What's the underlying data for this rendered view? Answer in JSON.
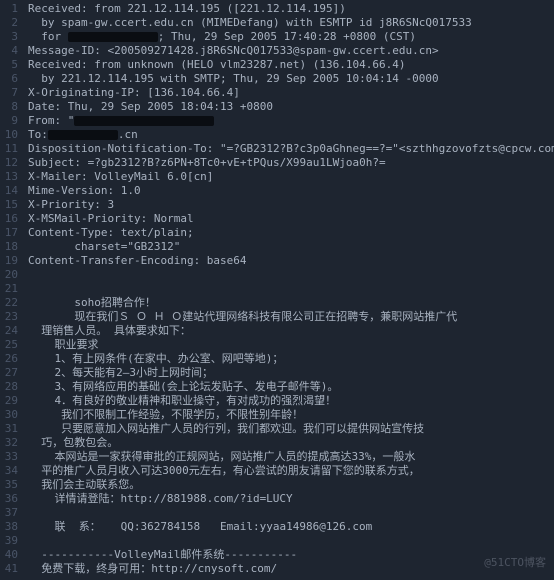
{
  "watermark": "@51CTO博客",
  "lines": [
    {
      "n": 1,
      "t": "Received: from 221.12.114.195 ([221.12.114.195])"
    },
    {
      "n": 2,
      "t": "  by spam-gw.ccert.edu.cn (MIMEDefang) with ESMTP id j8R6SNcQ017533"
    },
    {
      "n": 3,
      "t": "  for [REDACT:w1]; Thu, 29 Sep 2005 17:40:28 +0800 (CST)"
    },
    {
      "n": 4,
      "t": "Message-ID: <200509271428.j8R6SNcQ017533@spam-gw.ccert.edu.cn>"
    },
    {
      "n": 5,
      "t": "Received: from unknown (HELO vlm23287.net) (136.104.66.4)"
    },
    {
      "n": 6,
      "t": "  by 221.12.114.195 with SMTP; Thu, 29 Sep 2005 10:04:14 -0000"
    },
    {
      "n": 7,
      "t": "X-Originating-IP: [136.104.66.4]"
    },
    {
      "n": 8,
      "t": "Date: Thu, 29 Sep 2005 18:04:13 +0800"
    },
    {
      "n": 9,
      "t": "From: \"[REDACT:w2]"
    },
    {
      "n": 10,
      "t": "To:[REDACT:w3].cn"
    },
    {
      "n": 11,
      "t": "Disposition-Notification-To: \"=?GB2312?B?c3p0aGhneg==?=\"<szthhgzovofzts@cpcw.com>"
    },
    {
      "n": 12,
      "t": "Subject: =?gb2312?B?z6PN+8Tc0+vE+tPQus/X99au1LWjoa0h?="
    },
    {
      "n": 13,
      "t": "X-Mailer: VolleyMail 6.0[cn]"
    },
    {
      "n": 14,
      "t": "Mime-Version: 1.0"
    },
    {
      "n": 15,
      "t": "X-Priority: 3"
    },
    {
      "n": 16,
      "t": "X-MSMail-Priority: Normal"
    },
    {
      "n": 17,
      "t": "Content-Type: text/plain;"
    },
    {
      "n": 18,
      "t": "       charset=\"GB2312\""
    },
    {
      "n": 19,
      "t": "Content-Transfer-Encoding: base64"
    },
    {
      "n": 20,
      "t": ""
    },
    {
      "n": 21,
      "t": ""
    },
    {
      "n": 22,
      "t": "       soho招聘合作！"
    },
    {
      "n": 23,
      "t": "       现在我们Ｓ Ｏ Ｈ Ｏ建站代理网络科技有限公司正在招聘专，兼职网站推广代"
    },
    {
      "n": 24,
      "t": "  理销售人员。 具体要求如下："
    },
    {
      "n": 25,
      "t": "    职业要求"
    },
    {
      "n": 26,
      "t": "    1、有上网条件(在家中、办公室、网吧等地)；"
    },
    {
      "n": 27,
      "t": "    2、每天能有2—3小时上网时间；"
    },
    {
      "n": 28,
      "t": "    3、有网络应用的基础(会上论坛发贴子、发电子邮件等)。"
    },
    {
      "n": 29,
      "t": "    4．有良好的敬业精神和职业操守，有对成功的强烈渴望！"
    },
    {
      "n": 30,
      "t": "     我们不限制工作经验，不限学历，不限性别年龄！"
    },
    {
      "n": 31,
      "t": "     只要愿意加入网站推广人员的行列，我们都欢迎。我们可以提供网站宣传技"
    },
    {
      "n": 32,
      "t": "  巧，包教包会。"
    },
    {
      "n": 33,
      "t": "    本网站是一家获得审批的正规网站，网站推广人员的提成高达33%，一般水"
    },
    {
      "n": 34,
      "t": "  平的推广人员月收入可达3000元左右，有心尝试的朋友请留下您的联系方式，"
    },
    {
      "n": 35,
      "t": "  我们会主动联系您。"
    },
    {
      "n": 36,
      "t": "    详情请登陆：http://881988.com/?id=LUCY"
    },
    {
      "n": 37,
      "t": ""
    },
    {
      "n": 38,
      "t": "    联  系：   QQ:362784158   Email:yyaa14986@126.com"
    },
    {
      "n": 39,
      "t": ""
    },
    {
      "n": 40,
      "t": "  -----------VolleyMail邮件系统-----------"
    },
    {
      "n": 41,
      "t": "  免费下载，终身可用：http://cnysoft.com/"
    }
  ]
}
